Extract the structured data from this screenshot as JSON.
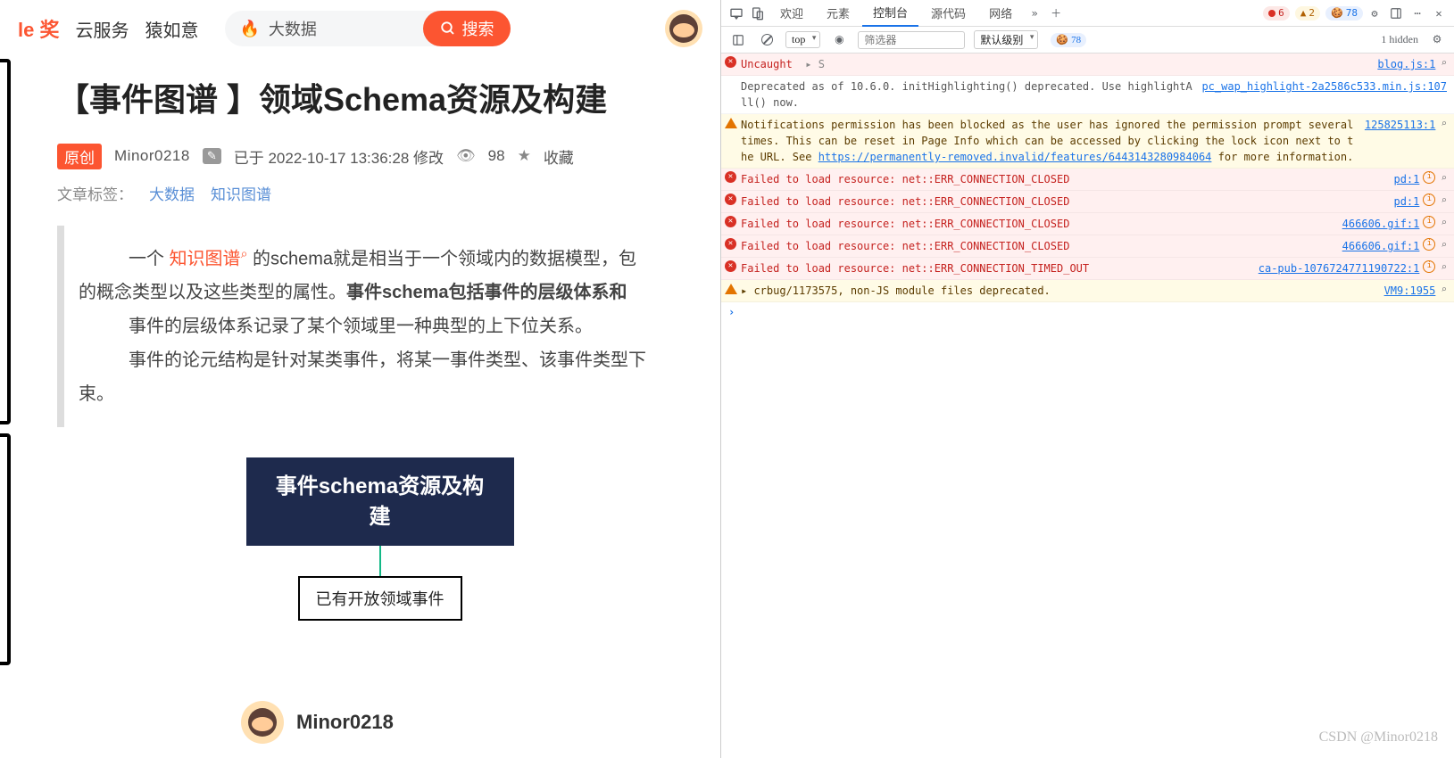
{
  "header": {
    "logo_fragment": "le 奖",
    "nav1": "云服务",
    "nav2": "猿如意",
    "search_hint": "大数据",
    "search_btn": "搜索"
  },
  "article": {
    "title": "【事件图谱 】领域Schema资源及构建",
    "orig_badge": "原创",
    "author": "Minor0218",
    "meta_edit": "已于 2022-10-17 13:36:28 修改",
    "views": "98",
    "collect": "收藏",
    "tag_label": "文章标签：",
    "tags": [
      "大数据",
      "知识图谱"
    ],
    "quote_p1_a": "一个 ",
    "quote_p1_link": "知识图谱",
    "quote_p1_b": " 的schema就是相当于一个领域内的数据模型，包",
    "quote_p2_a": "的概念类型以及这些类型的属性。",
    "quote_p2_bold": "事件schema包括事件的层级体系和",
    "quote_p3": "事件的层级体系记录了某个领域里一种典型的上下位关系。",
    "quote_p4": "事件的论元结构是针对某类事件，将某一事件类型、该事件类型下",
    "quote_p5": "束。",
    "mind_root": "事件schema资源及构建",
    "mind_child": "已有开放领域事件"
  },
  "devtools": {
    "tabs": {
      "welcome": "欢迎",
      "elements": "元素",
      "console": "控制台",
      "sources": "源代码",
      "network": "网络"
    },
    "badges": {
      "err": "6",
      "warn": "2",
      "info": "78"
    },
    "filter": {
      "top": "top",
      "placeholder": "筛选器",
      "level": "默认级别",
      "issues": "78",
      "hidden": "1 hidden"
    },
    "rows": [
      {
        "type": "err",
        "msg": "Uncaught",
        "extra": "▸ S",
        "src": "blog.js:1"
      },
      {
        "type": "plain",
        "msg": "Deprecated as of 10.6.0. initHighlighting() deprecated.  Use highlightAll() now.",
        "src": "pc_wap_highlight-2a2586c533.min.js:107"
      },
      {
        "type": "warn",
        "msg": "Notifications permission has been blocked as the user has ignored the permission prompt several times. This can be reset in Page Info which can be accessed by clicking the lock icon next to the URL. See ",
        "link": "https://permanently-removed.invalid/features/6443143280984064",
        "msg2": " for more information.",
        "src": "125825113:1"
      },
      {
        "type": "err",
        "msg": "Failed to load resource: net::ERR_CONNECTION_CLOSED",
        "src": "pd:1"
      },
      {
        "type": "err",
        "msg": "Failed to load resource: net::ERR_CONNECTION_CLOSED",
        "src": "pd:1"
      },
      {
        "type": "err",
        "msg": "Failed to load resource: net::ERR_CONNECTION_CLOSED",
        "src": "466606.gif:1"
      },
      {
        "type": "err",
        "msg": "Failed to load resource: net::ERR_CONNECTION_CLOSED",
        "src": "466606.gif:1"
      },
      {
        "type": "err",
        "msg": "Failed to load resource: net::ERR_CONNECTION_TIMED_OUT",
        "src": "ca-pub-1076724771190722:1"
      },
      {
        "type": "warn",
        "msg": "▸ crbug/1173575, non-JS module files deprecated.",
        "src": "VM9:1955"
      }
    ]
  },
  "watermark": "CSDN @Minor0218"
}
